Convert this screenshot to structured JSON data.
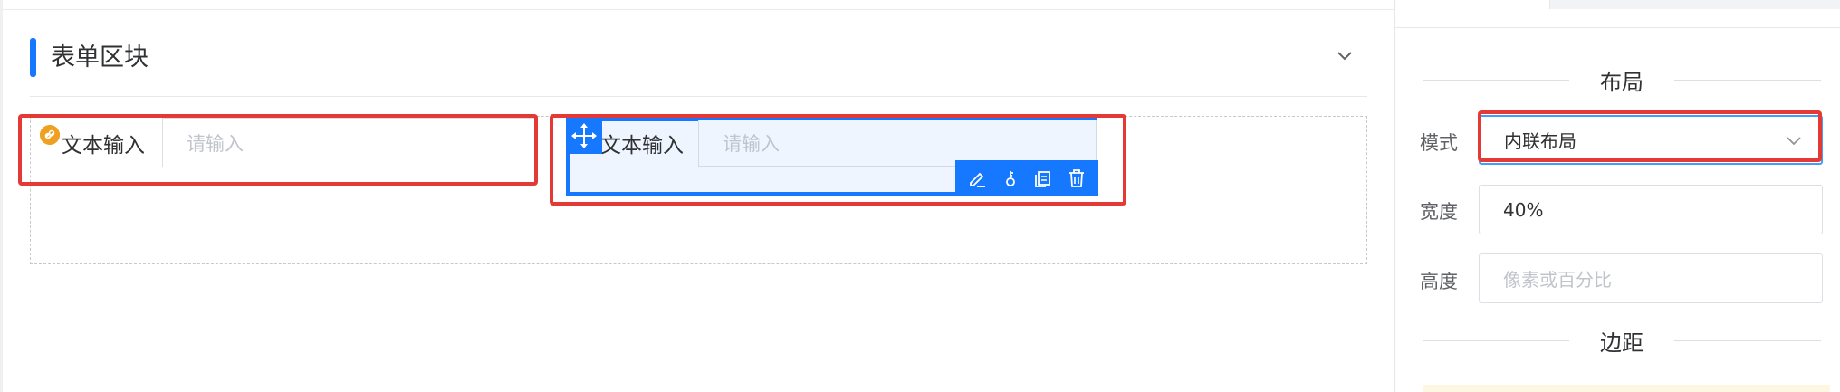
{
  "canvas": {
    "section": {
      "title": "表单区块"
    },
    "items": [
      {
        "label": "文本输入",
        "placeholder": "请输入"
      },
      {
        "label": "文本输入",
        "placeholder": "请输入"
      }
    ],
    "toolbar": {
      "icons": [
        "edit-icon",
        "key-icon",
        "copy-icon",
        "delete-icon"
      ]
    },
    "colors": {
      "accent": "#1677ff",
      "highlight": "#e53935",
      "link_badge": "#f0a020"
    }
  },
  "panel": {
    "layout_group": "布局",
    "mode": {
      "label": "模式",
      "value": "内联布局"
    },
    "width": {
      "label": "宽度",
      "value": "40%"
    },
    "height": {
      "label": "高度",
      "placeholder": "像素或百分比"
    },
    "spacing_group": "边距"
  }
}
